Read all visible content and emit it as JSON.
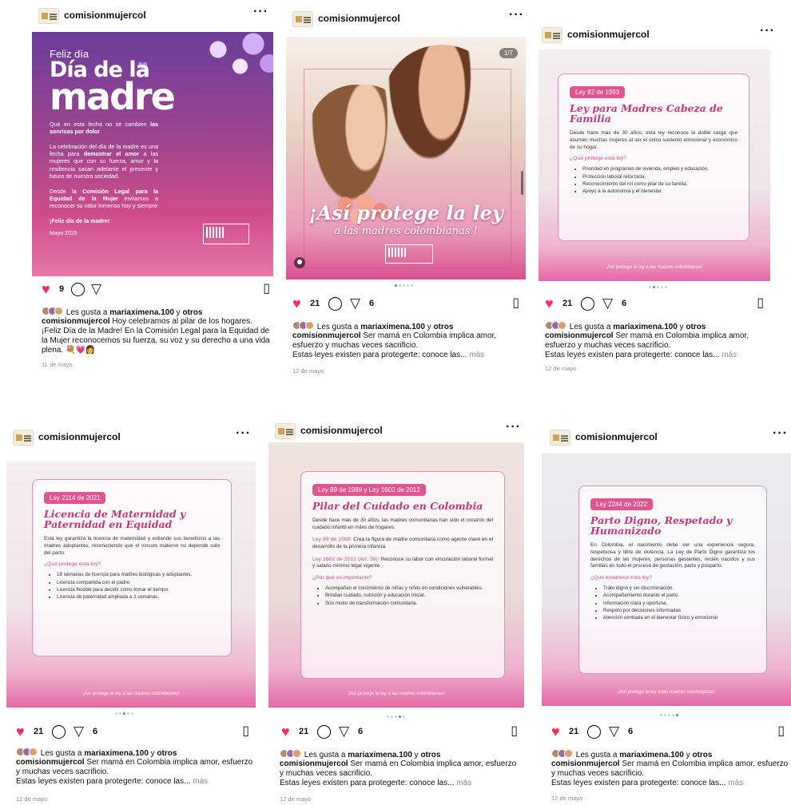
{
  "account": "comisionmujercol",
  "more_label": "···",
  "posts": [
    {
      "likes": "9",
      "shares": "",
      "liked_by_prefix": "Les gusta a ",
      "liked_by_user": "mariaximena.100",
      "liked_by_mid": " y ",
      "liked_by_others": "otros",
      "caption": "Hoy celebramos al pilar de los hogares. ¡Feliz Día de la Madre! En la Comisión Legal para la Equidad de la Mujer reconocemos su fuerza, su voz y su derecho a una vida plena. 💐💗👩",
      "caption_line2": "",
      "more": "",
      "date": "11 de mayo",
      "image": {
        "feliz": "Feliz día",
        "big": "Día de la",
        "huge": "madre",
        "p1a": "Que en esta fecha no se cambien",
        "p1b": "las sonrisas por dolor",
        "p2a": "La celebración del día de la madre es una fecha para",
        "p2b": "demostrar el amor",
        "p2c": "a las mujeres que con su fuerza, amor y la resiliencia sacan adelante el presente y futuro de nuestra sociedad.",
        "p3a": "Desde la",
        "p3b": "Comisión Legal para la Equidad de la Mujer",
        "p3c": "invitamos a reconocer su valor inmenso hoy y siempre",
        "p4": "¡Feliz día de la madre!",
        "date": "Mayo 2025"
      }
    },
    {
      "likes": "21",
      "shares": "6",
      "liked_by_prefix": "Les gusta a ",
      "liked_by_user": "mariaximena.100",
      "liked_by_mid": " y ",
      "liked_by_others": "otros",
      "caption": "Ser mamá en Colombia implica amor, esfuerzo y muchas veces sacrificio.",
      "caption_line2": "Estas leyes existen para protegerte: conoce las...",
      "more": "más",
      "date": "12 de mayo",
      "image": {
        "counter": "1/7",
        "title": "¡Así protege la ley",
        "subtitle": "a las madres colombianas !"
      }
    },
    {
      "likes": "21",
      "shares": "6",
      "liked_by_prefix": "Les gusta a ",
      "liked_by_user": "mariaximena.100",
      "liked_by_mid": " y ",
      "liked_by_others": "otros",
      "caption": "Ser mamá en Colombia implica amor, esfuerzo y muchas veces sacrificio.",
      "caption_line2": "Estas leyes existen para protegerte: conoce las...",
      "more": "más",
      "date": "12 de mayo",
      "image": {
        "pill": "Ley 82 de 1993",
        "title": "Ley para Madres Cabeza de Familia",
        "body": "Desde hace más de 30 años, esta ley reconoce la doble carga que asumen muchas mujeres al ser el único sustento emocional y económico de su hogar.",
        "question": "¿Qué protege esta ley?",
        "items": [
          "Prioridad en programas de vivienda, empleo y educación.",
          "Protección laboral reforzada.",
          "Reconocimiento del rol como pilar de su familia.",
          "Apoyo a la autonomía y el bienestar."
        ],
        "footer": "¡Así protege la ley a las madres colombianas!"
      }
    },
    {
      "likes": "21",
      "shares": "6",
      "liked_by_prefix": "Les gusta a ",
      "liked_by_user": "mariaximena.100",
      "liked_by_mid": " y ",
      "liked_by_others": "otros",
      "caption": "Ser mamá en Colombia implica amor, esfuerzo y muchas veces sacrificio.",
      "caption_line2": "Estas leyes existen para protegerte: conoce las...",
      "more": "más",
      "date": "12 de mayo",
      "image": {
        "pill": "Ley 2114 de 2021",
        "title": "Licencia de Maternidad y Paternidad en Equidad",
        "body": "Esta ley garantiza la licencia de maternidad y extiende sus beneficios a las madres adoptantes, reconociendo que el vínculo materno no depende solo del parto.",
        "question": "¿Qué protege esta ley?",
        "items": [
          "18 semanas de licencia para madres biológicas y adoptantes.",
          "Licencia compartida con el padre.",
          "Licencia flexible para decidir cómo tomar el tiempo.",
          "Licencia de paternidad ampliada a 2 semanas."
        ],
        "footer": "¡Así protege la ley a las madres colombianas!"
      }
    },
    {
      "likes": "21",
      "shares": "6",
      "liked_by_prefix": "Les gusta a ",
      "liked_by_user": "mariaximena.100",
      "liked_by_mid": " y ",
      "liked_by_others": "otros",
      "caption": "Ser mamá en Colombia implica amor, esfuerzo y muchas veces sacrificio.",
      "caption_line2": "Estas leyes existen para protegerte: conoce las...",
      "more": "más",
      "date": "12 de mayo",
      "image": {
        "pill": "Ley 89 de 1988 y Ley 1602 de 2012",
        "title": "Pilar del Cuidado en Colombia",
        "body": "Desde hace más de 30 años, las madres comunitarias han sido el corazón del cuidado infantil en miles de hogares.",
        "law1_label": "Ley 89 de 1988:",
        "law1_text": "Crea la figura de madre comunitaria como agente clave en el desarrollo de la primera infancia.",
        "law2_label": "Ley 1602 de 2012 (Art. 36):",
        "law2_text": "Reconoce su labor con vinculación laboral formal y salario mínimo legal vigente.",
        "question": "¿Por qué es importante?",
        "items": [
          "Acompañan el crecimiento de niñas y niños en condiciones vulnerables.",
          "Brindan cuidado, nutrición y educación inicial.",
          "Son motor de transformación comunitaria."
        ],
        "footer": "¡Así protege la ley a las madres colombianas!"
      }
    },
    {
      "likes": "21",
      "shares": "6",
      "liked_by_prefix": "Les gusta a ",
      "liked_by_user": "mariaximena.100",
      "liked_by_mid": " y ",
      "liked_by_others": "otros",
      "caption": "Ser mamá en Colombia implica amor, esfuerzo y muchas veces sacrificio.",
      "caption_line2": "Estas leyes existen para protegerte: conoce las...",
      "more": "más",
      "date": "12 de mayo",
      "image": {
        "pill": "Ley 2244 de 2022",
        "title": "Parto Digno, Respetado y Humanizado",
        "body": "En Colombia, el nacimiento debe ser una experiencia segura, respetuosa y libre de violencia. La Ley de Parto Digno garantiza los derechos de las mujeres, personas gestantes, recién nacidos y sus familias en todo el proceso de gestación, parto y posparto.",
        "question": "¿Qué establece esta ley?",
        "items": [
          "Trato digno y sin discriminación.",
          "Acompañamiento durante el parto.",
          "Información clara y oportuna.",
          "Respeto por decisiones informadas",
          "Atención centrada en el bienestar físico y emocional"
        ],
        "footer": "¡Así protege la ley a las madres colombianas!"
      }
    }
  ]
}
